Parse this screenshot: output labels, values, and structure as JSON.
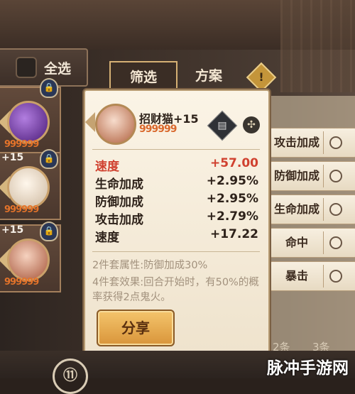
{
  "header": {
    "select_all_label": "全选"
  },
  "tabs": [
    {
      "label": "筛选",
      "active": true
    },
    {
      "label": "方案",
      "active": false
    }
  ],
  "soul_list": [
    {
      "plus": "",
      "stars": "999999",
      "portrait_color": "#7b3fb0"
    },
    {
      "plus": "+15",
      "stars": "999999",
      "portrait_color": "#f2e7d8"
    },
    {
      "plus": "+15",
      "stars": "999999",
      "portrait_color": "#c66a4a"
    }
  ],
  "detail": {
    "name": "招财猫+15",
    "stars": "999999",
    "main_stat": {
      "key": "速度",
      "value": "+57.00"
    },
    "sub_stats": [
      {
        "key": "生命加成",
        "value": "+2.95%"
      },
      {
        "key": "防御加成",
        "value": "+2.95%"
      },
      {
        "key": "攻击加成",
        "value": "+2.79%"
      },
      {
        "key": "速度",
        "value": "+17.22"
      }
    ],
    "set_2": "2件套属性:防御加成30%",
    "set_4": "4件套效果:回合开始时，有50%的概率获得2点鬼火。",
    "share_label": "分享"
  },
  "filters": [
    {
      "label": "攻击加成"
    },
    {
      "label": "防御加成"
    },
    {
      "label": "生命加成"
    },
    {
      "label": "命中"
    },
    {
      "label": "暴击"
    }
  ],
  "counts": [
    "2条",
    "3条"
  ],
  "watermark": "脉冲手游网",
  "bottom_button": "⑪",
  "colors": {
    "accent_red": "#d0412f",
    "star_orange": "#d9682c",
    "panel_bg": "#fbf4e6"
  }
}
